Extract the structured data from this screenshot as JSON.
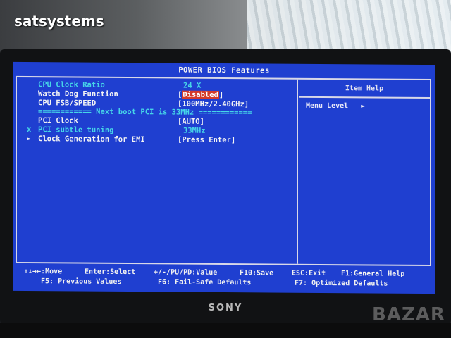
{
  "watermark": "satsystems",
  "monitor_brand": "SONY",
  "corner_logo": "BAZAR",
  "bios": {
    "title": "POWER BIOS Features",
    "help_title": "Item Help",
    "menu_level": "Menu Level",
    "menu_level_arrow": "►",
    "items": [
      {
        "label": "CPU Clock Ratio",
        "value": "24 X"
      },
      {
        "label": "Watch Dog Function",
        "value_open": "[",
        "value_sel": "Disabled",
        "value_close": "]"
      },
      {
        "label": "CPU FSB/SPEED",
        "value": "[100MHz/2.40GHz]"
      },
      {
        "label": "PCI Clock",
        "value": "[AUTO]"
      },
      {
        "label": "PCI subtle tuning",
        "value": "33MHz",
        "marker": "x"
      },
      {
        "label": "Clock Generation for EMI",
        "value": "[Press Enter]",
        "marker": "►"
      }
    ],
    "separator": "============ Next boot PCI is 33MHz ============",
    "footer": {
      "l1a": "↑↓→←:Move",
      "l1b": "Enter:Select",
      "l1c": "+/-/PU/PD:Value",
      "l1d": "F10:Save",
      "l1e": "ESC:Exit",
      "l1f": "F1:General Help",
      "l2a": "F5: Previous Values",
      "l2b": "F6: Fail-Safe Defaults",
      "l2c": "F7: Optimized Defaults"
    }
  }
}
